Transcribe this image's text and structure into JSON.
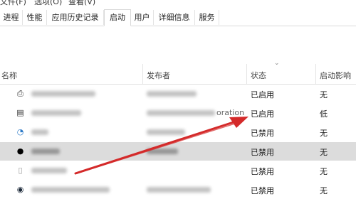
{
  "menu": {
    "file": "文件(F)",
    "options": "选项(O)",
    "view": "查看(V)"
  },
  "tabs": [
    {
      "label": "进程"
    },
    {
      "label": "性能"
    },
    {
      "label": "应用历史记录"
    },
    {
      "label": "启动"
    },
    {
      "label": "用户"
    },
    {
      "label": "详细信息"
    },
    {
      "label": "服务"
    }
  ],
  "active_tab": "启动",
  "columns": {
    "name": "名称",
    "publisher": "发布者",
    "status": "状态",
    "impact": "启动影响"
  },
  "rows": [
    {
      "icon": "printer-icon",
      "status": "已启用",
      "impact": "无",
      "publisher_tail": ""
    },
    {
      "icon": "notepad-icon",
      "status": "已启用",
      "impact": "低",
      "publisher_tail": "oration"
    },
    {
      "icon": "clock-icon",
      "status": "已禁用",
      "impact": "无",
      "publisher_tail": ""
    },
    {
      "icon": "penguin-icon",
      "status": "已禁用",
      "impact": "无",
      "publisher_tail": ""
    },
    {
      "icon": "document-icon",
      "status": "已禁用",
      "impact": "无",
      "publisher_tail": ""
    },
    {
      "icon": "steam-icon",
      "status": "已禁用",
      "impact": "无",
      "publisher_tail": ""
    }
  ],
  "annotation": {
    "arrow_color": "#d42a2a"
  }
}
